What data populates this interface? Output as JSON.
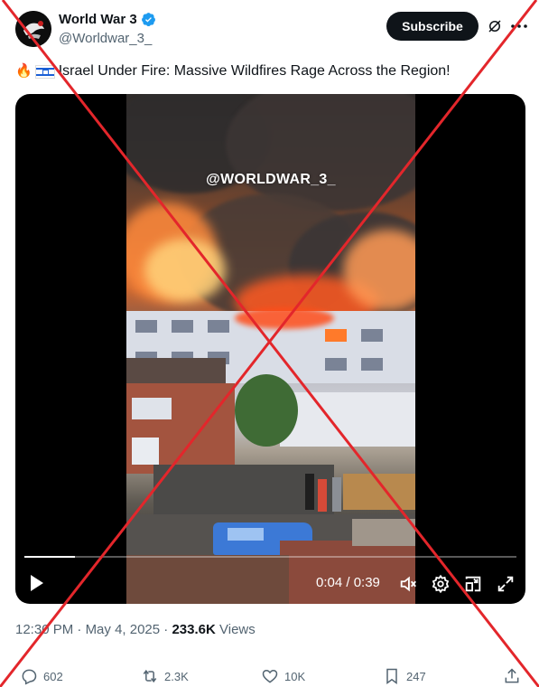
{
  "account": {
    "name": "World War 3",
    "handle": "@Worldwar_3_",
    "verified": true,
    "subscribe_label": "Subscribe"
  },
  "tweet": {
    "text": "Israel Under Fire: Massive Wildfires Rage Across the Region!",
    "emoji": "🔥",
    "flag": "israel-flag-icon"
  },
  "video": {
    "watermark": "@WORLDWAR_3_",
    "current_time": "0:04",
    "duration": "0:39",
    "time_display": "0:04 / 0:39",
    "progress_fraction": 0.103
  },
  "meta": {
    "time": "12:30 PM",
    "date": "May 4, 2025",
    "views": "233.6K",
    "views_label": "Views"
  },
  "actions": {
    "replies": "602",
    "reposts": "2.3K",
    "likes": "10K",
    "bookmarks": "247"
  },
  "colors": {
    "text": "#0f1419",
    "secondary": "#536471",
    "verified": "#1d9bf0",
    "overlay_cross": "#e3262b"
  }
}
